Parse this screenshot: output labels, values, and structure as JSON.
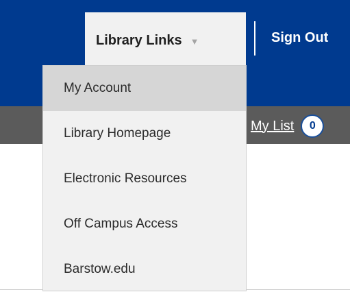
{
  "header": {
    "library_links_label": "Library Links",
    "caret_icon": "caret-down-icon",
    "sign_out_label": "Sign Out"
  },
  "subbar": {
    "my_list_label": "My List",
    "my_list_count": "0"
  },
  "dropdown": {
    "items": [
      {
        "label": "My Account",
        "active": true
      },
      {
        "label": "Library Homepage"
      },
      {
        "label": "Electronic Resources"
      },
      {
        "label": "Off Campus Access"
      },
      {
        "label": "Barstow.edu"
      }
    ]
  },
  "colors": {
    "header_blue": "#003a8f",
    "subbar_gray": "#5b5b5b",
    "menu_bg": "#f1f1f1",
    "menu_active_bg": "#d6d6d6"
  }
}
